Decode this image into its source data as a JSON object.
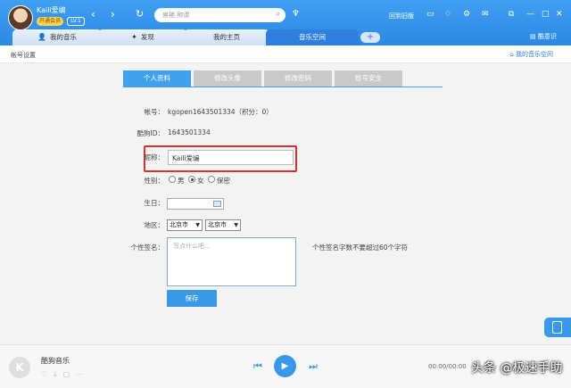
{
  "user": {
    "name": "Kaili爱编",
    "vip_badge": "开通会员",
    "level": "LV.1"
  },
  "top_nav": {
    "back": "‹",
    "forward": "›",
    "refresh": "↻"
  },
  "search": {
    "placeholder": "庾艳 称谓"
  },
  "top_right": {
    "old_version": "回到旧版"
  },
  "tabs": [
    {
      "label": "我的音乐",
      "icon": "user-icon"
    },
    {
      "label": "发现",
      "icon": "compass-icon"
    },
    {
      "label": "我的主页",
      "icon": ""
    },
    {
      "label": "音乐空间",
      "icon": "",
      "active": true
    }
  ],
  "add_tab": "+",
  "kugou_space": "酷意识",
  "subbar": {
    "title": "帐号设置",
    "my_space": "我的音乐空间"
  },
  "profile_tabs": [
    "个人资料",
    "修改头像",
    "修改密码",
    "账号安全"
  ],
  "form": {
    "account_label": "帐号：",
    "account_value": "kgopen1643501334（积分：0）",
    "kugou_id_label": "酷狗ID：",
    "kugou_id_value": "1643501334",
    "nickname_label": "昵称：",
    "nickname_value": "Kaili爱编",
    "gender_label": "性别：",
    "gender_options": [
      "男",
      "女",
      "保密"
    ],
    "gender_selected": "女",
    "birthday_label": "生日：",
    "region_label": "地区：",
    "province": "北京市",
    "city": "北京市",
    "signature_label": "个性签名：",
    "signature_placeholder": "写点什么吧...",
    "signature_hint": "个性签名字数不要超过60个字符",
    "save_label": "保存"
  },
  "player": {
    "title": "酷狗音乐",
    "time": "00:00/00:00"
  },
  "watermark": "头条 @极速手助",
  "colors": {
    "accent": "#3898ea",
    "highlight": "#d9322f"
  }
}
